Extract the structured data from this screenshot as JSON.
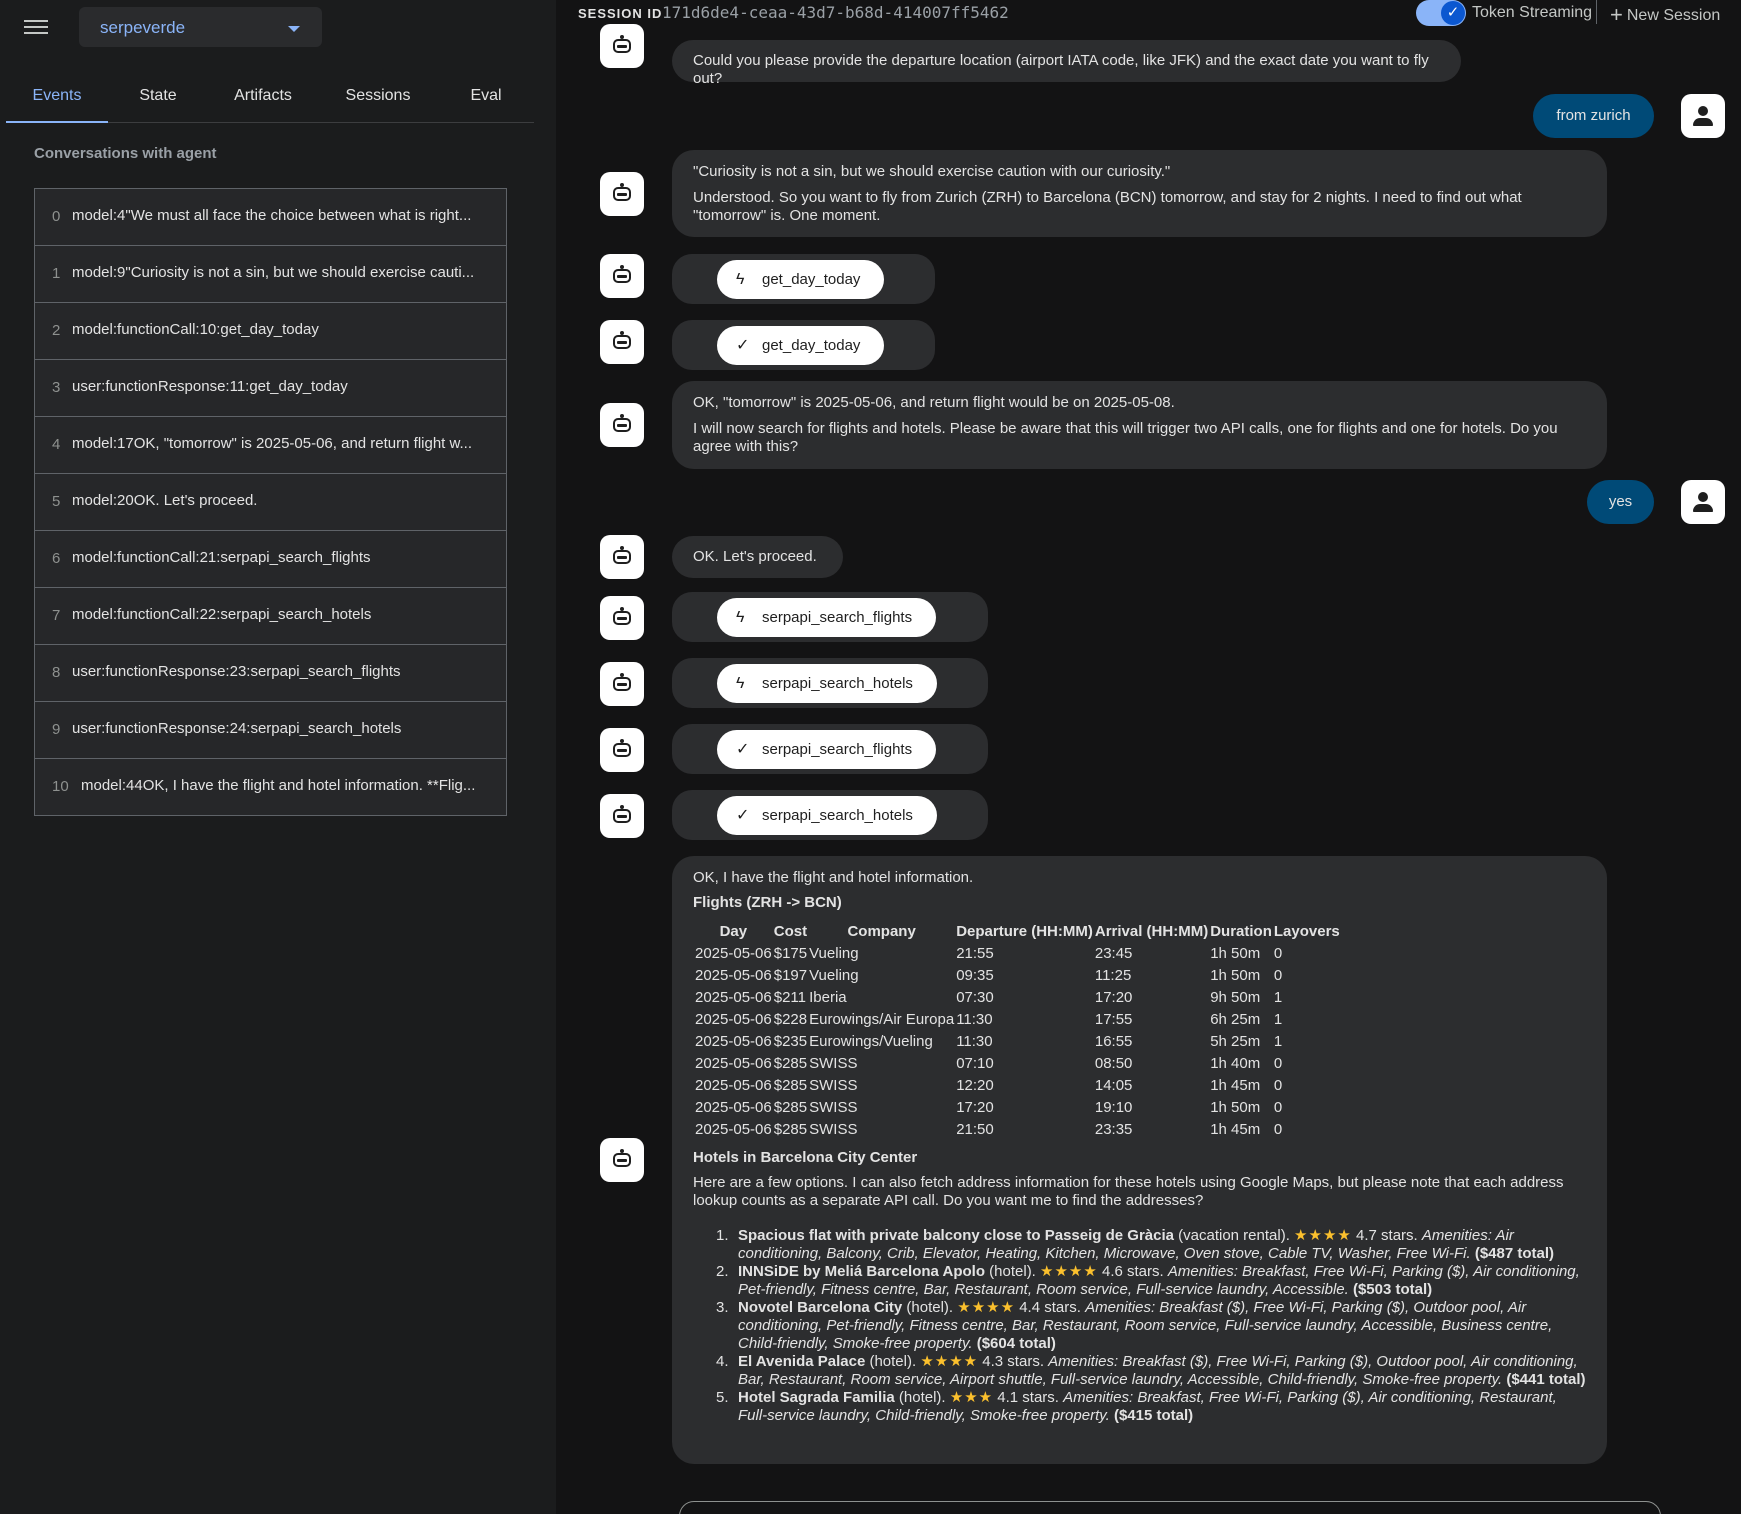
{
  "app": {
    "selected": "serpeverde"
  },
  "tabs": [
    "Events",
    "State",
    "Artifacts",
    "Sessions",
    "Eval"
  ],
  "left": {
    "title": "Conversations with agent",
    "events": [
      {
        "idx": "0",
        "text": "model:4\"We must all face the choice between what is right..."
      },
      {
        "idx": "1",
        "text": "model:9\"Curiosity is not a sin, but we should exercise cauti..."
      },
      {
        "idx": "2",
        "text": "model:functionCall:10:get_day_today"
      },
      {
        "idx": "3",
        "text": "user:functionResponse:11:get_day_today"
      },
      {
        "idx": "4",
        "text": "model:17OK, \"tomorrow\" is 2025-05-06, and return flight w..."
      },
      {
        "idx": "5",
        "text": "model:20OK. Let's proceed."
      },
      {
        "idx": "6",
        "text": "model:functionCall:21:serpapi_search_flights"
      },
      {
        "idx": "7",
        "text": "model:functionCall:22:serpapi_search_hotels"
      },
      {
        "idx": "8",
        "text": "user:functionResponse:23:serpapi_search_flights"
      },
      {
        "idx": "9",
        "text": "user:functionResponse:24:serpapi_search_hotels"
      },
      {
        "idx": "10",
        "text": "model:44OK, I have the flight and hotel information. **Flig..."
      }
    ]
  },
  "header": {
    "session_label": "SESSION ID",
    "session_id": "171d6de4-ceaa-43d7-b68d-414007ff5462",
    "streaming_label": "Token Streaming",
    "streaming_on": true,
    "new_session": "New Session"
  },
  "chat": {
    "m_departure": "Could you please provide the departure location (airport IATA code, like JFK) and the exact date you want to fly out?",
    "u_zurich": "from zurich",
    "m_curiosity_1": "\"Curiosity is not a sin, but we should exercise caution with our curiosity.\"",
    "m_curiosity_2": "Understood. So you want to fly from Zurich (ZRH) to Barcelona (BCN) tomorrow, and stay for 2 nights. I need to find out what \"tomorrow\" is. One moment.",
    "fn_call_1": "get_day_today",
    "fn_resp_1": "get_day_today",
    "m_tomorrow_1": "OK, \"tomorrow\" is 2025-05-06, and return flight would be on 2025-05-08.",
    "m_tomorrow_2": "I will now search for flights and hotels. Please be aware that this will trigger two API calls, one for flights and one for hotels. Do you agree with this?",
    "u_yes": "yes",
    "m_proceed": "OK. Let's proceed.",
    "fn_call_2": "serpapi_search_flights",
    "fn_call_3": "serpapi_search_hotels",
    "fn_resp_2": "serpapi_search_flights",
    "fn_resp_3": "serpapi_search_hotels",
    "final": {
      "intro": "OK, I have the flight and hotel information.",
      "flights_heading": "Flights (ZRH -> BCN)",
      "columns": [
        "Day",
        "Cost",
        "Company",
        "Departure (HH:MM)",
        "Arrival (HH:MM)",
        "Duration",
        "Layovers"
      ],
      "rows": [
        [
          "2025-05-06",
          "$175",
          "Vueling",
          "21:55",
          "23:45",
          "1h 50m",
          "0"
        ],
        [
          "2025-05-06",
          "$197",
          "Vueling",
          "09:35",
          "11:25",
          "1h 50m",
          "0"
        ],
        [
          "2025-05-06",
          "$211",
          "Iberia",
          "07:30",
          "17:20",
          "9h 50m",
          "1"
        ],
        [
          "2025-05-06",
          "$228",
          "Eurowings/Air Europa",
          "11:30",
          "17:55",
          "6h 25m",
          "1"
        ],
        [
          "2025-05-06",
          "$235",
          "Eurowings/Vueling",
          "11:30",
          "16:55",
          "5h 25m",
          "1"
        ],
        [
          "2025-05-06",
          "$285",
          "SWISS",
          "07:10",
          "08:50",
          "1h 40m",
          "0"
        ],
        [
          "2025-05-06",
          "$285",
          "SWISS",
          "12:20",
          "14:05",
          "1h 45m",
          "0"
        ],
        [
          "2025-05-06",
          "$285",
          "SWISS",
          "17:20",
          "19:10",
          "1h 50m",
          "0"
        ],
        [
          "2025-05-06",
          "$285",
          "SWISS",
          "21:50",
          "23:35",
          "1h 45m",
          "0"
        ]
      ],
      "hotels_heading": "Hotels in Barcelona City Center",
      "hotels_intro": "Here are a few options. I can also fetch address information for these hotels using Google Maps, but please note that each address lookup counts as a separate API call. Do you want me to find the addresses?",
      "hotels": [
        {
          "num": "1.",
          "name": "Spacious flat with private balcony close to Passeig de Gràcia",
          "type": " (vacation rental). ",
          "stars": "★★★★",
          "rating": " 4.7 stars. ",
          "amenities": "Amenities: Air conditioning, Balcony, Crib, Elevator, Heating, Kitchen, Microwave, Oven stove, Cable TV, Washer, Free Wi-Fi.",
          "total": " ($487 total)"
        },
        {
          "num": "2.",
          "name": "INNSiDE by Meliá Barcelona Apolo",
          "type": " (hotel). ",
          "stars": "★★★★",
          "rating": " 4.6 stars. ",
          "amenities": "Amenities: Breakfast, Free Wi-Fi, Parking ($), Air conditioning, Pet-friendly, Fitness centre, Bar, Restaurant, Room service, Full-service laundry, Accessible.",
          "total": " ($503 total)"
        },
        {
          "num": "3.",
          "name": "Novotel Barcelona City",
          "type": " (hotel). ",
          "stars": "★★★★",
          "rating": " 4.4 stars. ",
          "amenities": "Amenities: Breakfast ($), Free Wi-Fi, Parking ($), Outdoor pool, Air conditioning, Pet-friendly, Fitness centre, Bar, Restaurant, Room service, Full-service laundry, Accessible, Business centre, Child-friendly, Smoke-free property.",
          "total": " ($604 total)"
        },
        {
          "num": "4.",
          "name": "El Avenida Palace",
          "type": " (hotel). ",
          "stars": "★★★★",
          "rating": " 4.3 stars. ",
          "amenities": "Amenities: Breakfast ($), Free Wi-Fi, Parking ($), Outdoor pool, Air conditioning, Bar, Restaurant, Room service, Airport shuttle, Full-service laundry, Accessible, Child-friendly, Smoke-free property.",
          "total": " ($441 total)"
        },
        {
          "num": "5.",
          "name": "Hotel Sagrada Familia",
          "type": " (hotel). ",
          "stars": "★★★",
          "rating": " 4.1 stars. ",
          "amenities": "Amenities: Breakfast, Free Wi-Fi, Parking ($), Air conditioning, Restaurant, Full-service laundry, Child-friendly, Smoke-free property.",
          "total": " ($415 total)"
        }
      ]
    }
  }
}
